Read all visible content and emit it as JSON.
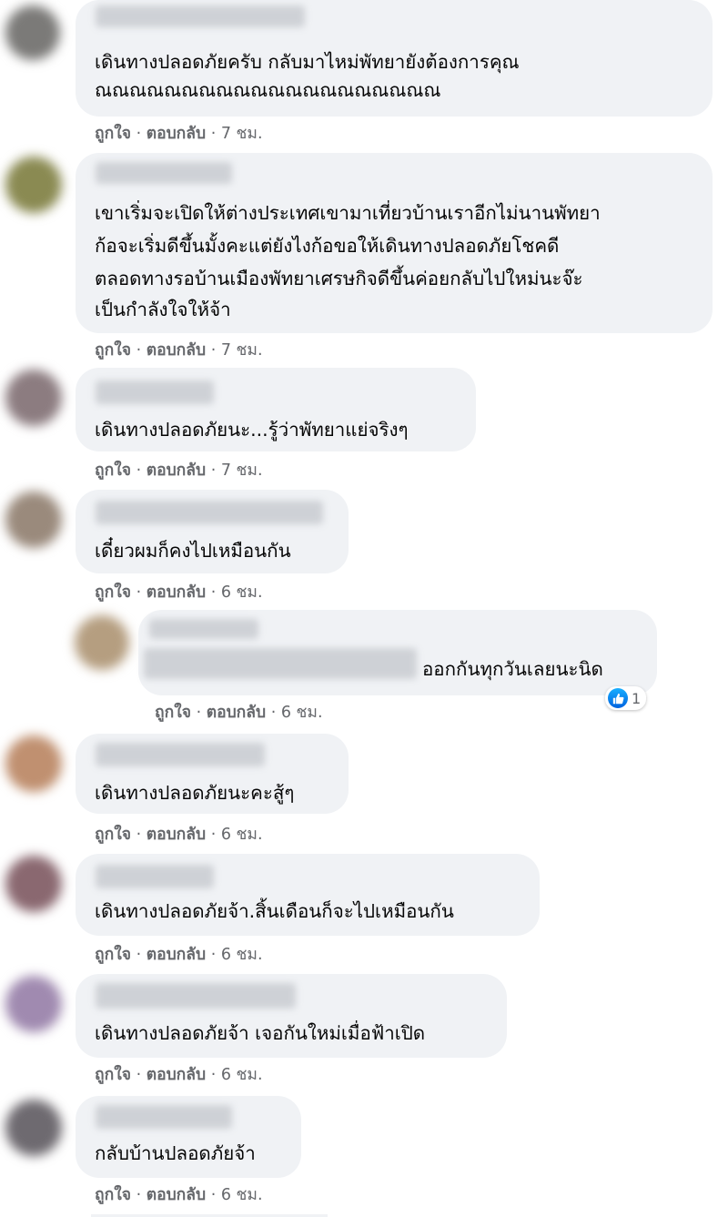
{
  "meta_labels": {
    "like": "ถูกใจ",
    "reply": "ตอบกลับ",
    "sep": " · "
  },
  "comments": [
    {
      "lines": [
        "เดินทางปลอดภัยครับ กลับมาไหม่พัทยายังต้องการคุณ",
        "ณณณณณณณณณณณณณณณณณณณณ"
      ],
      "time": "7 ชม."
    },
    {
      "lines": [
        "เขาเริ่มจะเปิดให้ต่างประเทศเขามาเที่ยวบ้านเราอีกไม่นานพัทยา",
        "ก้อจะเริ่มดีขึ้นมั้งคะแต่ยังไงก้อขอให้เดินทางปลอดภัยโชคดี",
        "ตลอดทางรอบ้านเมืองพัทยาเศรษกิจดีขึ้นค่อยกลับไปใหม่นะจ๊ะ",
        "เป็นกำลังใจให้จ้า"
      ],
      "time": "7 ชม."
    },
    {
      "lines": [
        "เดินทางปลอดภัยนะ...รู้ว่าพัทยาแย่จริงๆ"
      ],
      "time": "7 ชม."
    },
    {
      "lines": [
        "เดี๋ยวผมก็คงไปเหมือนกัน"
      ],
      "time": "6 ชม."
    },
    {
      "lines": [
        "ออกกันทุกวันเลยนะนิด"
      ],
      "time": "6 ชม.",
      "reactions": "1"
    },
    {
      "lines": [
        "เดินทางปลอดภัยนะคะสู้ๆ"
      ],
      "time": "6 ชม."
    },
    {
      "lines": [
        "เดินทางปลอดภัยจ้า.สิ้นเดือนก็จะไปเหมือนกัน"
      ],
      "time": "6 ชม."
    },
    {
      "lines": [
        "เดินทางปลอดภัยจ้า เจอกันใหม่เมื่อฟ้าเปิด"
      ],
      "time": "6 ชม."
    },
    {
      "lines": [
        "กลับบ้านปลอดภัยจ้า"
      ],
      "time": "6 ชม."
    }
  ],
  "icons": {
    "reaction": "like-thumb-icon"
  },
  "colors": {
    "bubble": "#f0f2f5",
    "meta": "#65676b",
    "text": "#050505",
    "like_blue": "#1877f2"
  }
}
